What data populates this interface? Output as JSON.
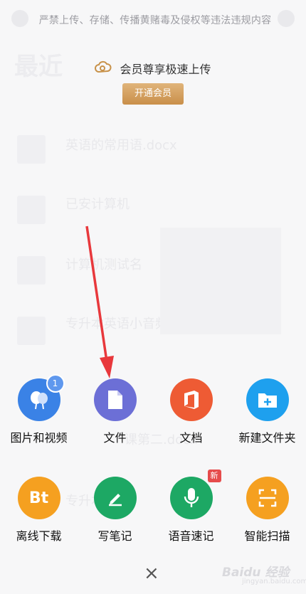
{
  "top_notice": "严禁上传、存储、传播黄赌毒及侵权等违法违规内容",
  "page_title": "最近",
  "vip": {
    "text": "会员尊享极速上传",
    "button": "开通会员"
  },
  "background_items": [
    {
      "title": "英语的常用语.docx"
    },
    {
      "title": "已安计算机"
    },
    {
      "title": "计算机测试名"
    },
    {
      "title": "专升本英语小音频"
    },
    {
      "title": "课第二.docx"
    },
    {
      "title": "专升本英语"
    }
  ],
  "actions_row1": [
    {
      "label": "图片和视频",
      "icon": "balloon-icon",
      "color": "#3a82e6",
      "badge": "1"
    },
    {
      "label": "文件",
      "icon": "file-icon",
      "color": "#6c6fd6"
    },
    {
      "label": "文档",
      "icon": "office-icon",
      "color": "#ee5b34"
    },
    {
      "label": "新建文件夹",
      "icon": "new-folder-icon",
      "color": "#1ea0ee"
    }
  ],
  "actions_row2": [
    {
      "label": "离线下载",
      "icon": "bt-icon",
      "color": "#f5a020",
      "glyph": "Bt"
    },
    {
      "label": "写笔记",
      "icon": "pencil-icon",
      "color": "#1da864"
    },
    {
      "label": "语音速记",
      "icon": "microphone-icon",
      "color": "#1da864",
      "badge": "新"
    },
    {
      "label": "智能扫描",
      "icon": "scan-icon",
      "color": "#f5a020"
    }
  ],
  "close_symbol": "×",
  "watermark": "Baidu 经验",
  "watermark_sub": "jingyan.baidu.com",
  "annotation_color": "#e8383c"
}
